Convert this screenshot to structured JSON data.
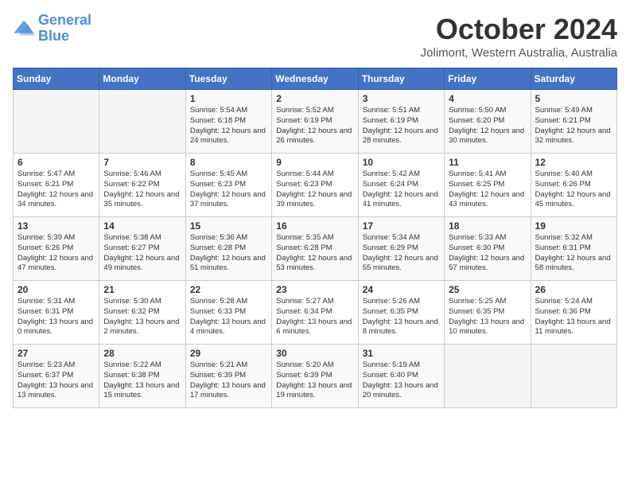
{
  "header": {
    "logo_line1": "General",
    "logo_line2": "Blue",
    "month_title": "October 2024",
    "subtitle": "Jolimont, Western Australia, Australia"
  },
  "days_of_week": [
    "Sunday",
    "Monday",
    "Tuesday",
    "Wednesday",
    "Thursday",
    "Friday",
    "Saturday"
  ],
  "weeks": [
    [
      {
        "day": "",
        "empty": true
      },
      {
        "day": "",
        "empty": true
      },
      {
        "day": "1",
        "sunrise": "5:54 AM",
        "sunset": "6:18 PM",
        "daylight": "12 hours and 24 minutes."
      },
      {
        "day": "2",
        "sunrise": "5:52 AM",
        "sunset": "6:19 PM",
        "daylight": "12 hours and 26 minutes."
      },
      {
        "day": "3",
        "sunrise": "5:51 AM",
        "sunset": "6:19 PM",
        "daylight": "12 hours and 28 minutes."
      },
      {
        "day": "4",
        "sunrise": "5:50 AM",
        "sunset": "6:20 PM",
        "daylight": "12 hours and 30 minutes."
      },
      {
        "day": "5",
        "sunrise": "5:49 AM",
        "sunset": "6:21 PM",
        "daylight": "12 hours and 32 minutes."
      }
    ],
    [
      {
        "day": "6",
        "sunrise": "5:47 AM",
        "sunset": "6:21 PM",
        "daylight": "12 hours and 34 minutes."
      },
      {
        "day": "7",
        "sunrise": "5:46 AM",
        "sunset": "6:22 PM",
        "daylight": "12 hours and 35 minutes."
      },
      {
        "day": "8",
        "sunrise": "5:45 AM",
        "sunset": "6:23 PM",
        "daylight": "12 hours and 37 minutes."
      },
      {
        "day": "9",
        "sunrise": "5:44 AM",
        "sunset": "6:23 PM",
        "daylight": "12 hours and 39 minutes."
      },
      {
        "day": "10",
        "sunrise": "5:42 AM",
        "sunset": "6:24 PM",
        "daylight": "12 hours and 41 minutes."
      },
      {
        "day": "11",
        "sunrise": "5:41 AM",
        "sunset": "6:25 PM",
        "daylight": "12 hours and 43 minutes."
      },
      {
        "day": "12",
        "sunrise": "5:40 AM",
        "sunset": "6:26 PM",
        "daylight": "12 hours and 45 minutes."
      }
    ],
    [
      {
        "day": "13",
        "sunrise": "5:39 AM",
        "sunset": "6:26 PM",
        "daylight": "12 hours and 47 minutes."
      },
      {
        "day": "14",
        "sunrise": "5:38 AM",
        "sunset": "6:27 PM",
        "daylight": "12 hours and 49 minutes."
      },
      {
        "day": "15",
        "sunrise": "5:36 AM",
        "sunset": "6:28 PM",
        "daylight": "12 hours and 51 minutes."
      },
      {
        "day": "16",
        "sunrise": "5:35 AM",
        "sunset": "6:28 PM",
        "daylight": "12 hours and 53 minutes."
      },
      {
        "day": "17",
        "sunrise": "5:34 AM",
        "sunset": "6:29 PM",
        "daylight": "12 hours and 55 minutes."
      },
      {
        "day": "18",
        "sunrise": "5:33 AM",
        "sunset": "6:30 PM",
        "daylight": "12 hours and 57 minutes."
      },
      {
        "day": "19",
        "sunrise": "5:32 AM",
        "sunset": "6:31 PM",
        "daylight": "12 hours and 58 minutes."
      }
    ],
    [
      {
        "day": "20",
        "sunrise": "5:31 AM",
        "sunset": "6:31 PM",
        "daylight": "13 hours and 0 minutes."
      },
      {
        "day": "21",
        "sunrise": "5:30 AM",
        "sunset": "6:32 PM",
        "daylight": "13 hours and 2 minutes."
      },
      {
        "day": "22",
        "sunrise": "5:28 AM",
        "sunset": "6:33 PM",
        "daylight": "13 hours and 4 minutes."
      },
      {
        "day": "23",
        "sunrise": "5:27 AM",
        "sunset": "6:34 PM",
        "daylight": "13 hours and 6 minutes."
      },
      {
        "day": "24",
        "sunrise": "5:26 AM",
        "sunset": "6:35 PM",
        "daylight": "13 hours and 8 minutes."
      },
      {
        "day": "25",
        "sunrise": "5:25 AM",
        "sunset": "6:35 PM",
        "daylight": "13 hours and 10 minutes."
      },
      {
        "day": "26",
        "sunrise": "5:24 AM",
        "sunset": "6:36 PM",
        "daylight": "13 hours and 11 minutes."
      }
    ],
    [
      {
        "day": "27",
        "sunrise": "5:23 AM",
        "sunset": "6:37 PM",
        "daylight": "13 hours and 13 minutes."
      },
      {
        "day": "28",
        "sunrise": "5:22 AM",
        "sunset": "6:38 PM",
        "daylight": "13 hours and 15 minutes."
      },
      {
        "day": "29",
        "sunrise": "5:21 AM",
        "sunset": "6:39 PM",
        "daylight": "13 hours and 17 minutes."
      },
      {
        "day": "30",
        "sunrise": "5:20 AM",
        "sunset": "6:39 PM",
        "daylight": "13 hours and 19 minutes."
      },
      {
        "day": "31",
        "sunrise": "5:19 AM",
        "sunset": "6:40 PM",
        "daylight": "13 hours and 20 minutes."
      },
      {
        "day": "",
        "empty": true
      },
      {
        "day": "",
        "empty": true
      }
    ]
  ]
}
